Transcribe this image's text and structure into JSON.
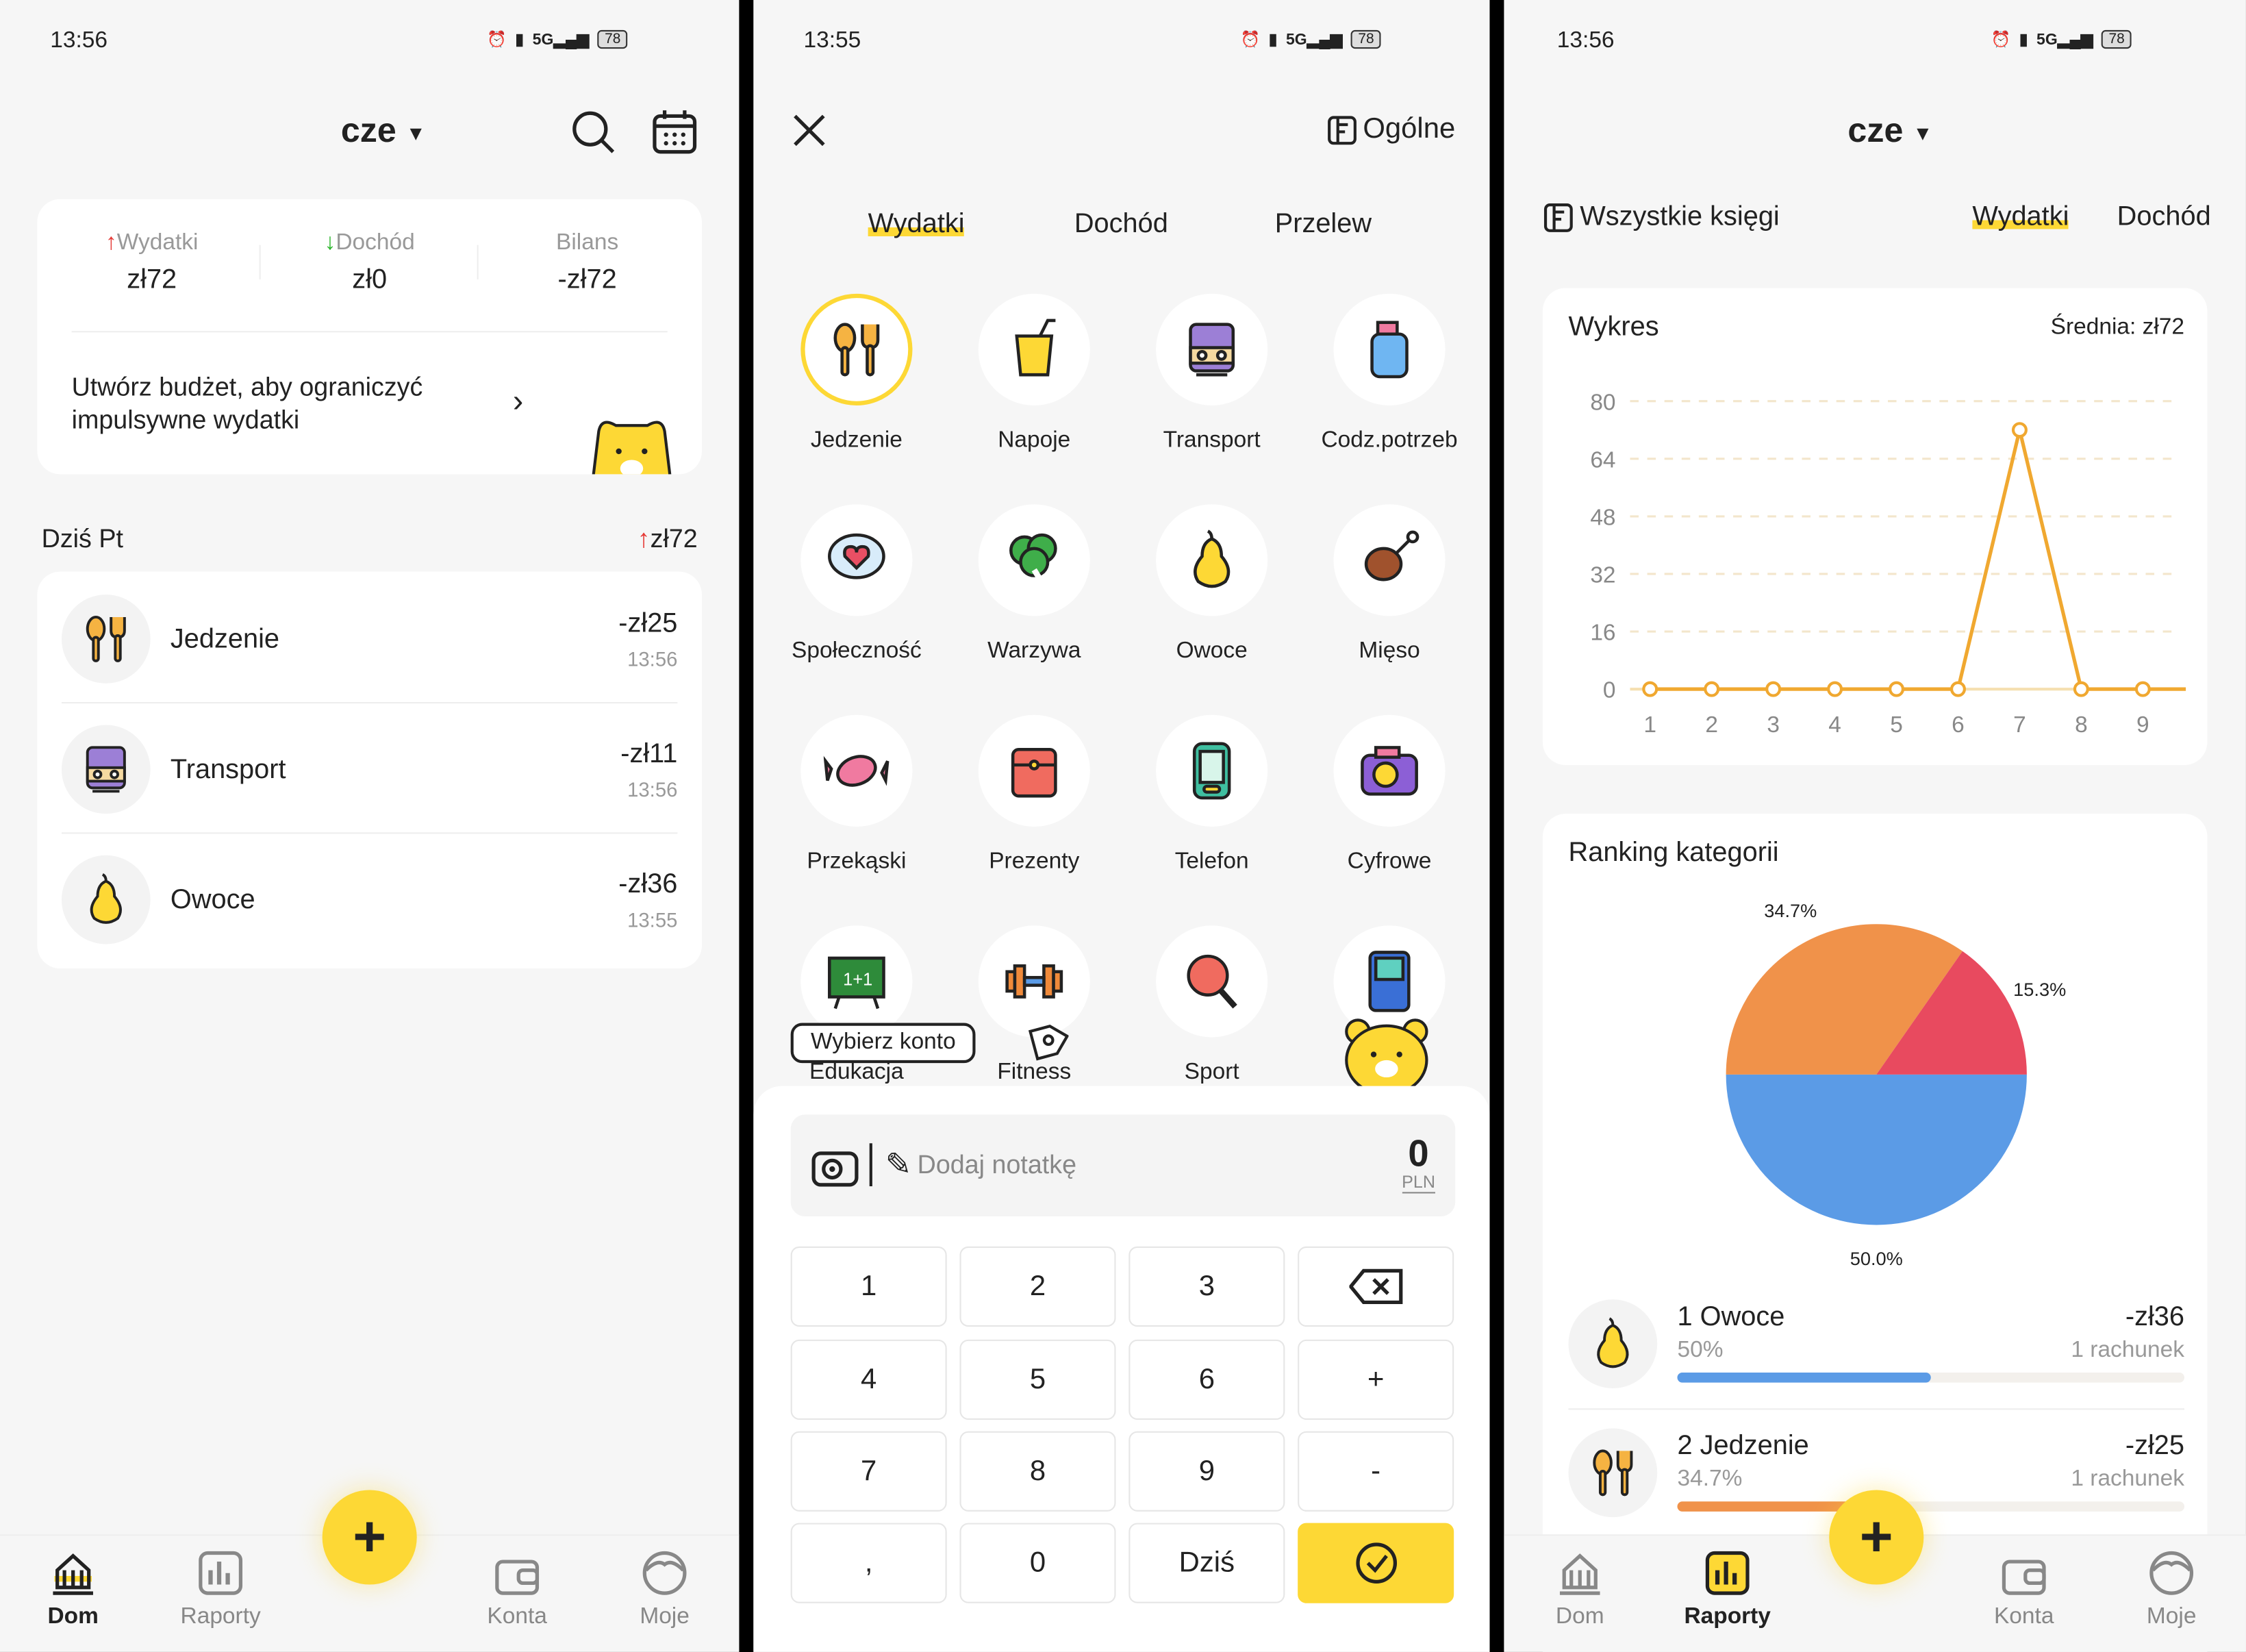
{
  "home": {
    "status_time": "13:56",
    "battery": "78",
    "month": "cze",
    "summary": {
      "expenses_label": "Wydatki",
      "expenses_value": "zł72",
      "income_label": "Dochód",
      "income_value": "zł0",
      "balance_label": "Bilans",
      "balance_value": "-zł72"
    },
    "budget_prompt": "Utwórz budżet, aby ograniczyć impulsywne wydatki",
    "day_label": "Dziś Pt",
    "day_total": "zł72",
    "transactions": [
      {
        "icon": "fork-spoon-icon",
        "name": "Jedzenie",
        "amount": "-zł25",
        "time": "13:56"
      },
      {
        "icon": "train-icon",
        "name": "Transport",
        "amount": "-zł11",
        "time": "13:56"
      },
      {
        "icon": "pear-icon",
        "name": "Owoce",
        "amount": "-zł36",
        "time": "13:55"
      }
    ]
  },
  "add": {
    "status_time": "13:55",
    "battery": "78",
    "book_label": "Ogólne",
    "tabs": [
      "Wydatki",
      "Dochód",
      "Przelew"
    ],
    "active_tab": "Wydatki",
    "categories": [
      {
        "name": "Jedzenie",
        "icon": "fork-spoon-icon",
        "color": "#f5b342"
      },
      {
        "name": "Napoje",
        "icon": "drink-icon",
        "color": "#fdd835"
      },
      {
        "name": "Transport",
        "icon": "train-icon",
        "color": "#9c7fd6"
      },
      {
        "name": "Codz.potrzeb",
        "icon": "bottle-icon",
        "color": "#6fb6f2"
      },
      {
        "name": "Społeczność",
        "icon": "chat-heart-icon",
        "color": "#e94f64"
      },
      {
        "name": "Warzywa",
        "icon": "broccoli-icon",
        "color": "#3fae4a"
      },
      {
        "name": "Owoce",
        "icon": "pear-icon",
        "color": "#fdd835"
      },
      {
        "name": "Mięso",
        "icon": "drumstick-icon",
        "color": "#a0522d"
      },
      {
        "name": "Przekąski",
        "icon": "candy-icon",
        "color": "#f07aa0"
      },
      {
        "name": "Prezenty",
        "icon": "gift-icon",
        "color": "#f06b5f"
      },
      {
        "name": "Telefon",
        "icon": "phone-icon",
        "color": "#3fbfa0"
      },
      {
        "name": "Cyfrowe",
        "icon": "camera-icon",
        "color": "#8c5fd6"
      },
      {
        "name": "Edukacja",
        "icon": "blackboard-icon",
        "color": "#2e8b3a"
      },
      {
        "name": "Fitness",
        "icon": "dumbbell-icon",
        "color": "#f08a3a"
      },
      {
        "name": "Sport",
        "icon": "ping-pong-icon",
        "color": "#f06b5f"
      },
      {
        "name": "",
        "icon": "gameboy-icon",
        "color": "#3a6fd6"
      }
    ],
    "account_tooltip": "Wybierz konto",
    "note_placeholder": "Dodaj notatkę",
    "amount": "0",
    "currency": "PLN",
    "keys": [
      "1",
      "2",
      "3",
      "⌫",
      "4",
      "5",
      "6",
      "+",
      "7",
      "8",
      "9",
      "-",
      ",",
      "0",
      "Dziś",
      "✓"
    ]
  },
  "reports": {
    "status_time": "13:56",
    "battery": "78",
    "month": "cze",
    "books_label": "Wszystkie księgi",
    "tabs": [
      "Wydatki",
      "Dochód"
    ],
    "active_tab": "Wydatki",
    "chart_title": "Wykres",
    "average": "Średnia: zł72",
    "ranking_title": "Ranking kategorii",
    "ranking": [
      {
        "rank": "1",
        "name": "Owoce",
        "percent_label": "50%",
        "fraction": 0.5,
        "amount": "-zł36",
        "count": "1 rachunek",
        "color": "#5b9be6",
        "icon": "pear-icon"
      },
      {
        "rank": "2",
        "name": "Jedzenie",
        "percent_label": "34.7%",
        "fraction": 0.347,
        "amount": "-zł25",
        "count": "1 rachunek",
        "color": "#f0924a",
        "icon": "fork-spoon-icon"
      }
    ]
  },
  "nav": {
    "home": "Dom",
    "reports": "Raporty",
    "accounts": "Konta",
    "mine": "Moje"
  },
  "colors": {
    "accent": "#fdd835",
    "expense": "#e53935",
    "income": "#2bb52b",
    "line": "#f0a830"
  },
  "chart_data": [
    {
      "type": "line",
      "title": "Wykres",
      "x": [
        1,
        2,
        3,
        4,
        5,
        6,
        7,
        8,
        9
      ],
      "values": [
        0,
        0,
        0,
        0,
        0,
        0,
        72,
        0,
        0
      ],
      "yticks": [
        0,
        16,
        32,
        48,
        64,
        80
      ],
      "ylim": [
        0,
        80
      ],
      "grid": true
    },
    {
      "type": "pie",
      "title": "Ranking kategorii",
      "slices": [
        {
          "label": "50.0%",
          "value": 50.0,
          "color": "#5b9be6"
        },
        {
          "label": "34.7%",
          "value": 34.7,
          "color": "#f0924a"
        },
        {
          "label": "15.3%",
          "value": 15.3,
          "color": "#e84a5f"
        }
      ]
    }
  ]
}
